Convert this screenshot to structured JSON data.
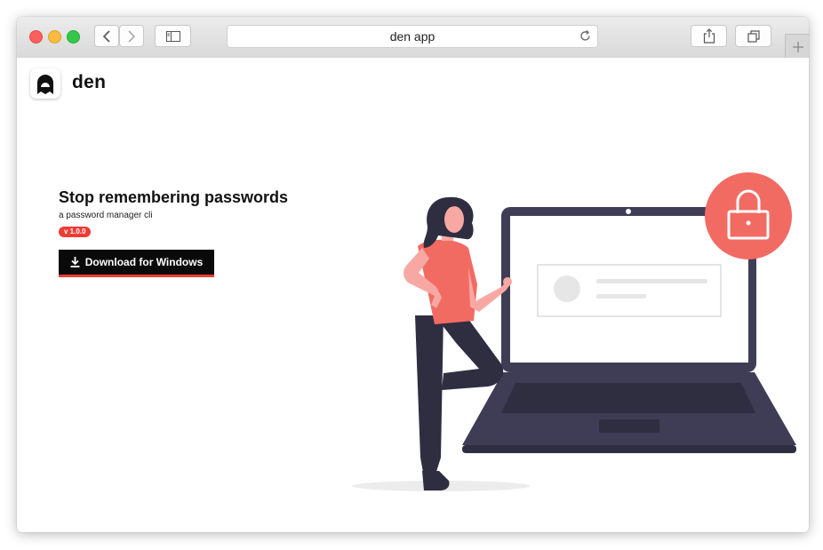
{
  "browser": {
    "address_text": "den app",
    "icons": [
      "back-icon",
      "forward-icon",
      "sidebar-icon",
      "reload-icon",
      "share-icon",
      "tabs-icon",
      "plus-icon"
    ]
  },
  "app": {
    "brand": "den",
    "headline": "Stop remembering passwords",
    "subtitle": "a password manager cli",
    "version_badge": "v 1.0.0",
    "download_label": "Download for Windows"
  },
  "colors": {
    "accent": "#ef3b35",
    "illustration_coral": "#f26b63",
    "illustration_dark": "#3f3d56",
    "button_bg": "#0a0a0a"
  }
}
